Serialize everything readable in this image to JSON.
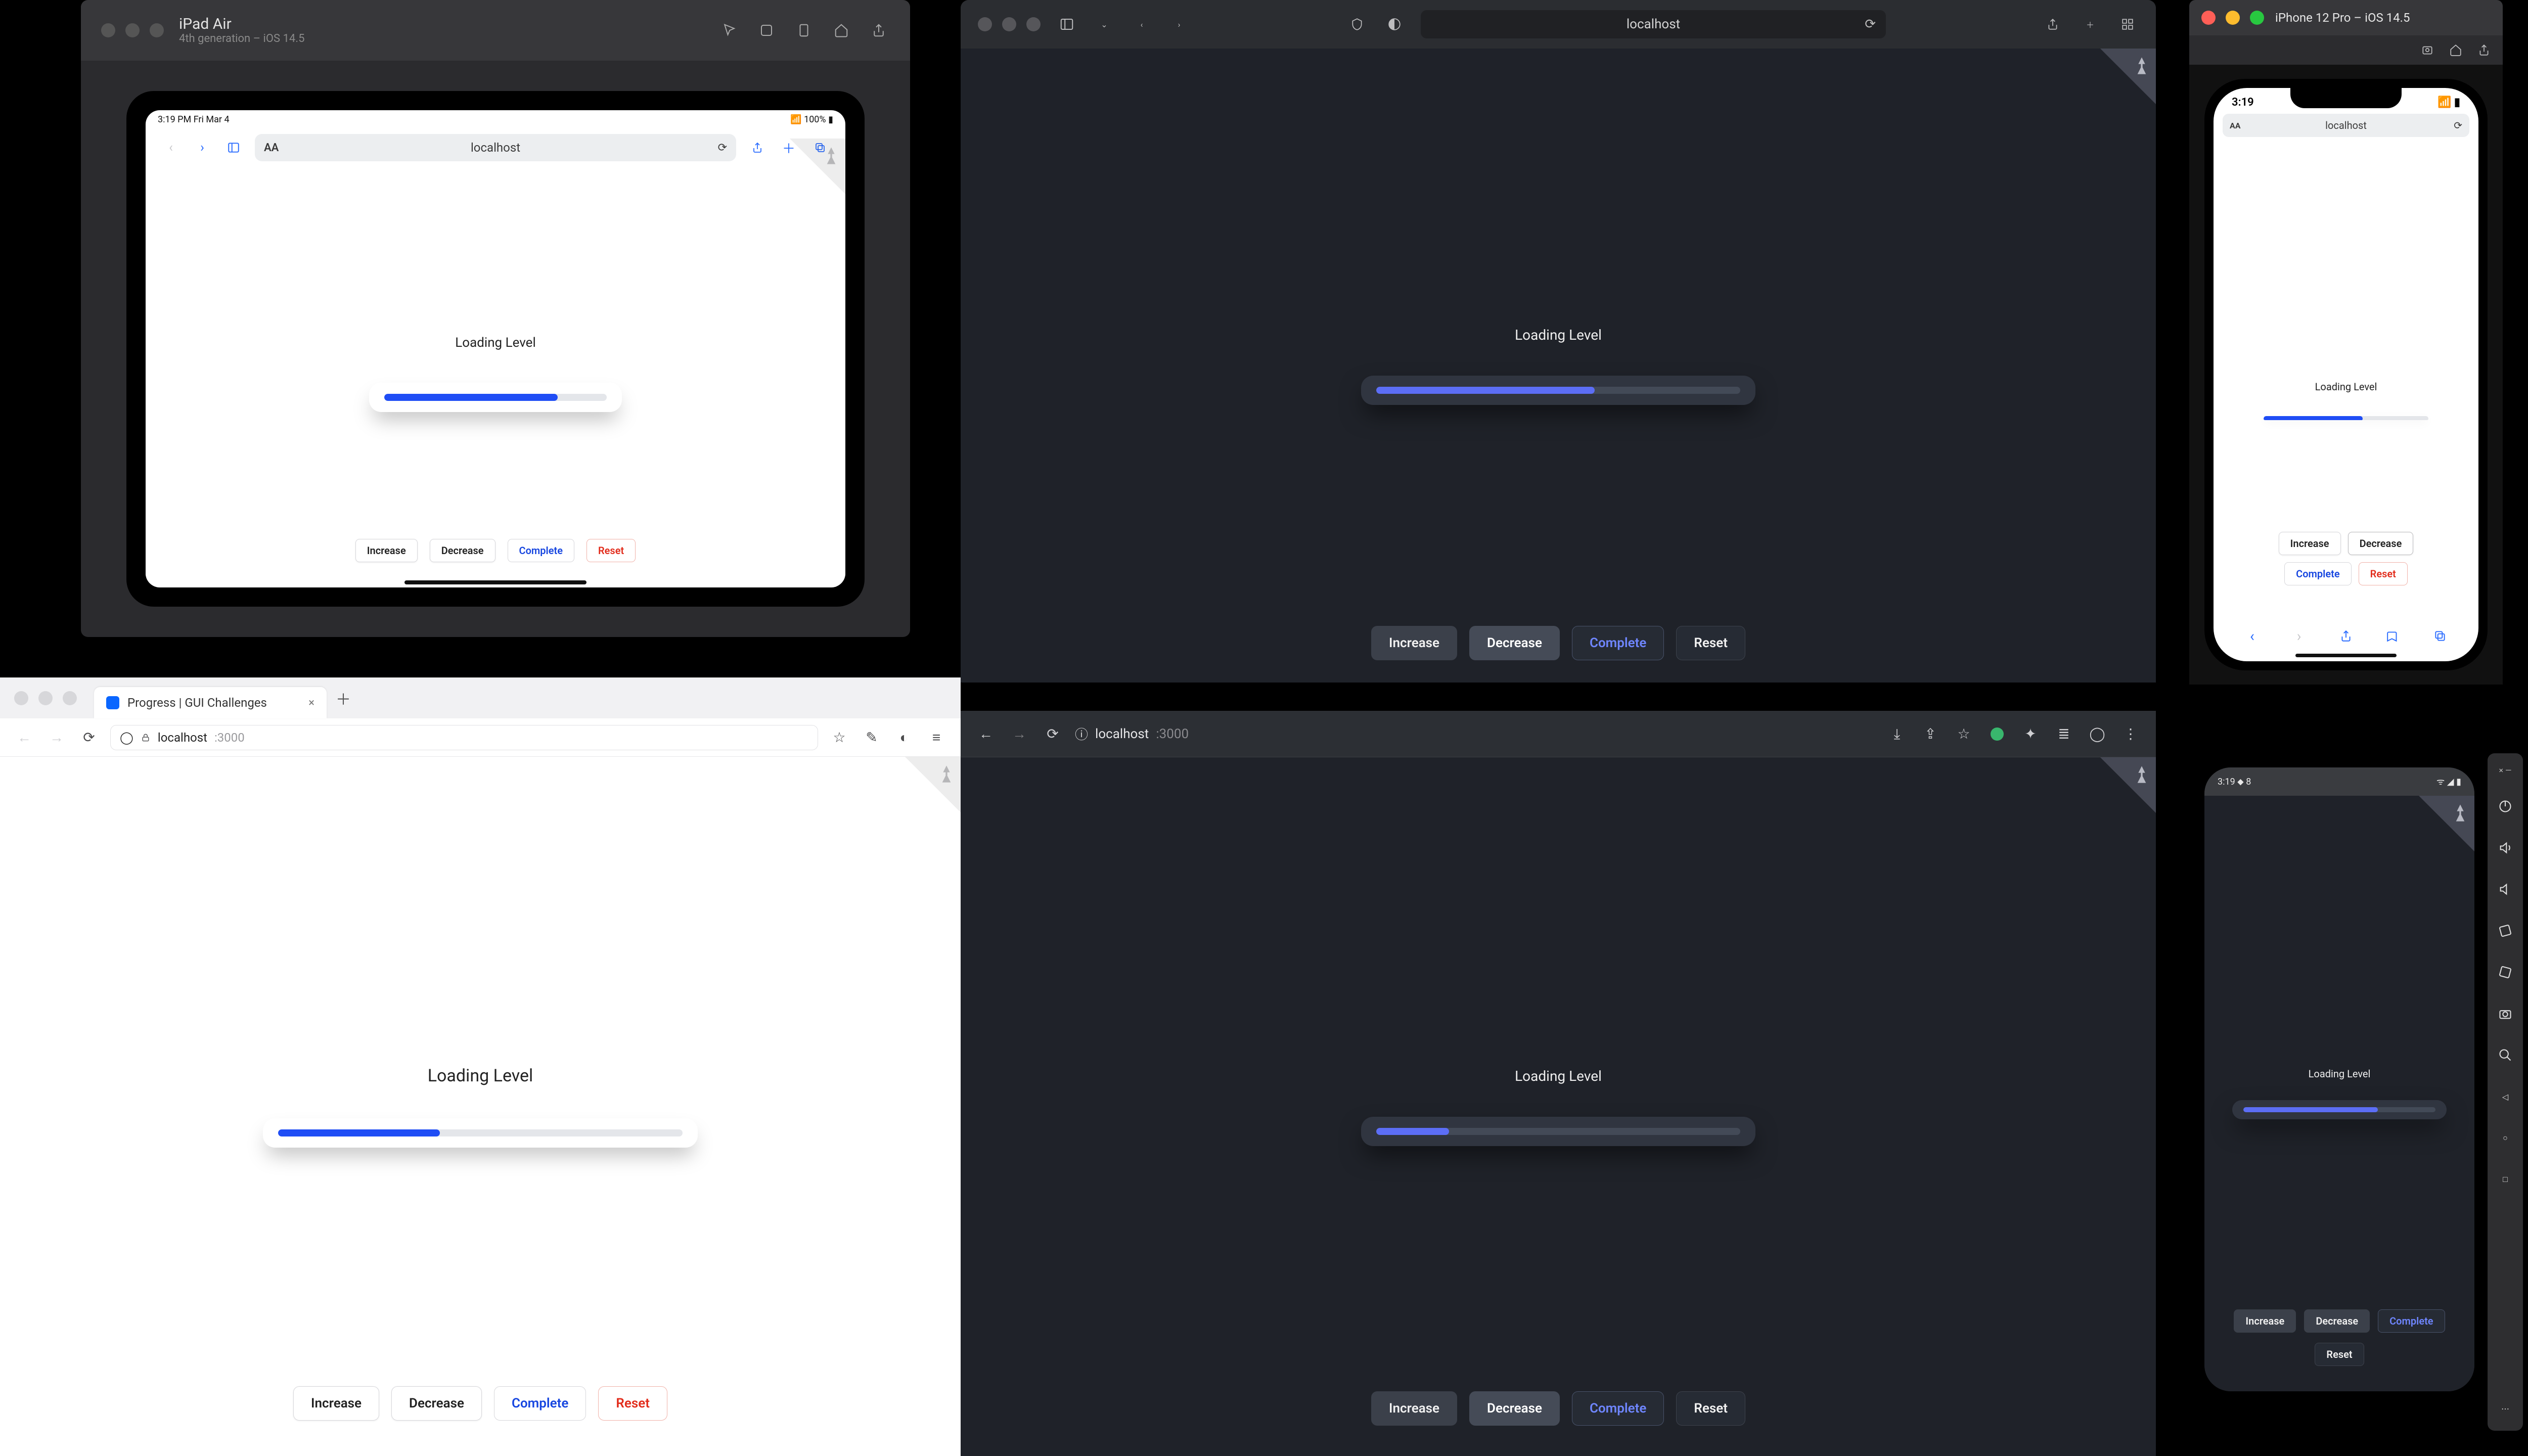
{
  "ipad": {
    "title": "iPad Air",
    "subtitle": "4th generation – iOS 14.5",
    "status_time": "3:19 PM  Fri Mar 4",
    "status_right": "100%",
    "url": "localhost"
  },
  "safari_mac": {
    "url": "localhost"
  },
  "firefox": {
    "tab_title": "Progress | GUI Challenges",
    "host": "localhost",
    "port": ":3000"
  },
  "chrome_dark": {
    "host": "localhost",
    "port": ":3000"
  },
  "iphone": {
    "title": "iPhone 12 Pro – iOS 14.5",
    "time": "3:19",
    "url": "localhost"
  },
  "android": {
    "time": "3:19",
    "wifi": "8"
  },
  "app": {
    "label": "Loading Level",
    "buttons": {
      "increase": "Increase",
      "decrease": "Decrease",
      "complete": "Complete",
      "reset": "Reset"
    }
  },
  "progress_pct": {
    "ipad": 78,
    "safari_mac": 60,
    "firefox": 40,
    "chrome_dark": 20,
    "iphone": 60,
    "android": 70
  }
}
